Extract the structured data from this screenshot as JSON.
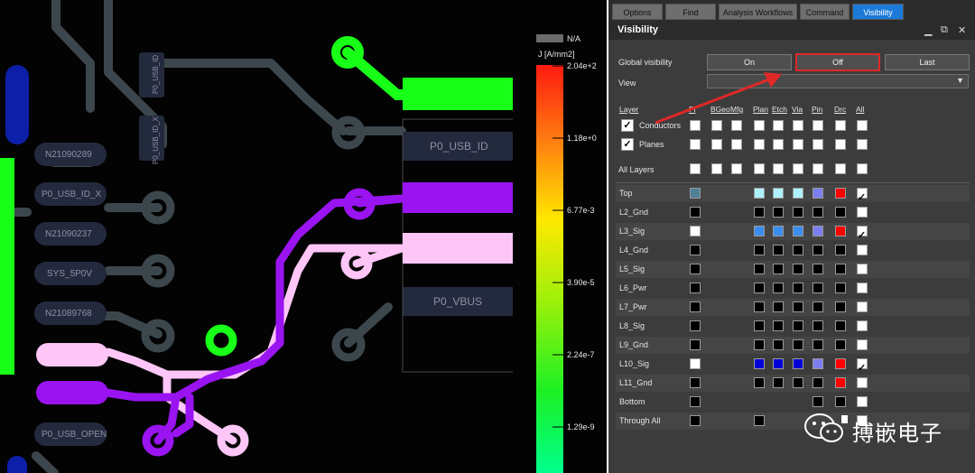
{
  "canvas": {
    "pin_labels": [
      "P0_USB_ID",
      "P0_VBUS"
    ],
    "rotated_labels": [
      "P0_USB_ID",
      "P0_USB_ID_X"
    ],
    "net_labels": [
      "N21090289",
      "P0_USB_ID_X",
      "N21090237",
      "SYS_5P0V",
      "N21089768",
      "P0_USB_OPEN"
    ],
    "legend": {
      "na_label": "N/A",
      "unit_label": "J [A/mm2]",
      "ticks": [
        "2.04e+2",
        "1.18e+0",
        "6.77e-3",
        "3.90e-5",
        "2.24e-7",
        "1.29e-9"
      ]
    }
  },
  "panel": {
    "tabs": [
      {
        "label": "Options"
      },
      {
        "label": "Find"
      },
      {
        "label": "Analysis Workflows"
      },
      {
        "label": "Command"
      },
      {
        "label": "Visibility",
        "active": true
      }
    ],
    "title": "Visibility",
    "window_buttons": {
      "minimize": "▁",
      "restore": "⧉",
      "close": "✕"
    },
    "global_visibility_label": "Global visibility",
    "buttons": {
      "on": "On",
      "off": "Off",
      "last": "Last"
    },
    "view_label": "View",
    "view_value": "",
    "column_headers": [
      "Layer",
      "Pl",
      "BGeo",
      "Mfg",
      "Plan",
      "Etch",
      "Via",
      "Pin",
      "Drc",
      "All"
    ],
    "groups": [
      {
        "label": "Conductors",
        "checked": true
      },
      {
        "label": "Planes",
        "checked": true
      }
    ],
    "all_layers_label": "All Layers",
    "layers": [
      {
        "name": "Top",
        "pl": "#4f8296",
        "bgeo": "",
        "mfg": "",
        "plan": "#aef0ff",
        "etch": "#aef0ff",
        "via": "#aef0ff",
        "pin": "#7d7ef0",
        "drc": "#ff0000",
        "all": true
      },
      {
        "name": "L2_Gnd",
        "pl": "#000000",
        "bgeo": "",
        "mfg": "",
        "plan": "#000000",
        "etch": "#000000",
        "via": "#000000",
        "pin": "#000000",
        "drc": "#000000",
        "all": false
      },
      {
        "name": "L3_Sig",
        "pl": "#ffffff",
        "bgeo": "",
        "mfg": "",
        "plan": "#3a8ef0",
        "etch": "#3a8ef0",
        "via": "#3a8ef0",
        "pin": "#7d7ef0",
        "drc": "#ff0000",
        "all": true
      },
      {
        "name": "L4_Gnd",
        "pl": "#000000",
        "bgeo": "",
        "mfg": "",
        "plan": "#000000",
        "etch": "#000000",
        "via": "#000000",
        "pin": "#000000",
        "drc": "#000000",
        "all": false
      },
      {
        "name": "L5_Sig",
        "pl": "#000000",
        "bgeo": "",
        "mfg": "",
        "plan": "#000000",
        "etch": "#000000",
        "via": "#000000",
        "pin": "#000000",
        "drc": "#000000",
        "all": false
      },
      {
        "name": "L6_Pwr",
        "pl": "#000000",
        "bgeo": "",
        "mfg": "",
        "plan": "#000000",
        "etch": "#000000",
        "via": "#000000",
        "pin": "#000000",
        "drc": "#000000",
        "all": false
      },
      {
        "name": "L7_Pwr",
        "pl": "#000000",
        "bgeo": "",
        "mfg": "",
        "plan": "#000000",
        "etch": "#000000",
        "via": "#000000",
        "pin": "#000000",
        "drc": "#000000",
        "all": false
      },
      {
        "name": "L8_Sig",
        "pl": "#000000",
        "bgeo": "",
        "mfg": "",
        "plan": "#000000",
        "etch": "#000000",
        "via": "#000000",
        "pin": "#000000",
        "drc": "#000000",
        "all": false
      },
      {
        "name": "L9_Gnd",
        "pl": "#000000",
        "bgeo": "",
        "mfg": "",
        "plan": "#000000",
        "etch": "#000000",
        "via": "#000000",
        "pin": "#000000",
        "drc": "#000000",
        "all": false
      },
      {
        "name": "L10_Sig",
        "pl": "#ffffff",
        "bgeo": "",
        "mfg": "",
        "plan": "#0000d8",
        "etch": "#0000d8",
        "via": "#0000d8",
        "pin": "#7d7ef0",
        "drc": "#ff0000",
        "all": true
      },
      {
        "name": "L11_Gnd",
        "pl": "#000000",
        "bgeo": "",
        "mfg": "",
        "plan": "#000000",
        "etch": "#000000",
        "via": "#000000",
        "pin": "#000000",
        "drc": "#ff0000",
        "all": false
      },
      {
        "name": "Bottom",
        "pl": "#000000",
        "bgeo": "",
        "mfg": "",
        "plan": "",
        "etch": "",
        "via": "",
        "pin": "#000000",
        "drc": "#000000",
        "all": false
      },
      {
        "name": "Through All",
        "pl": "#000000",
        "bgeo": "",
        "mfg": "",
        "plan": "#000000",
        "etch": "",
        "via": "",
        "pin": "",
        "drc": "",
        "all": false
      }
    ]
  },
  "watermark": {
    "text": "搏嵌电子"
  },
  "colors": {
    "accent": "#1c7ad9",
    "highlight": "#e02828",
    "trace_grey": "#3c474d",
    "trace_purple": "#9a14f2",
    "trace_pink": "#fdc6f7",
    "trace_green": "#18ff18"
  }
}
